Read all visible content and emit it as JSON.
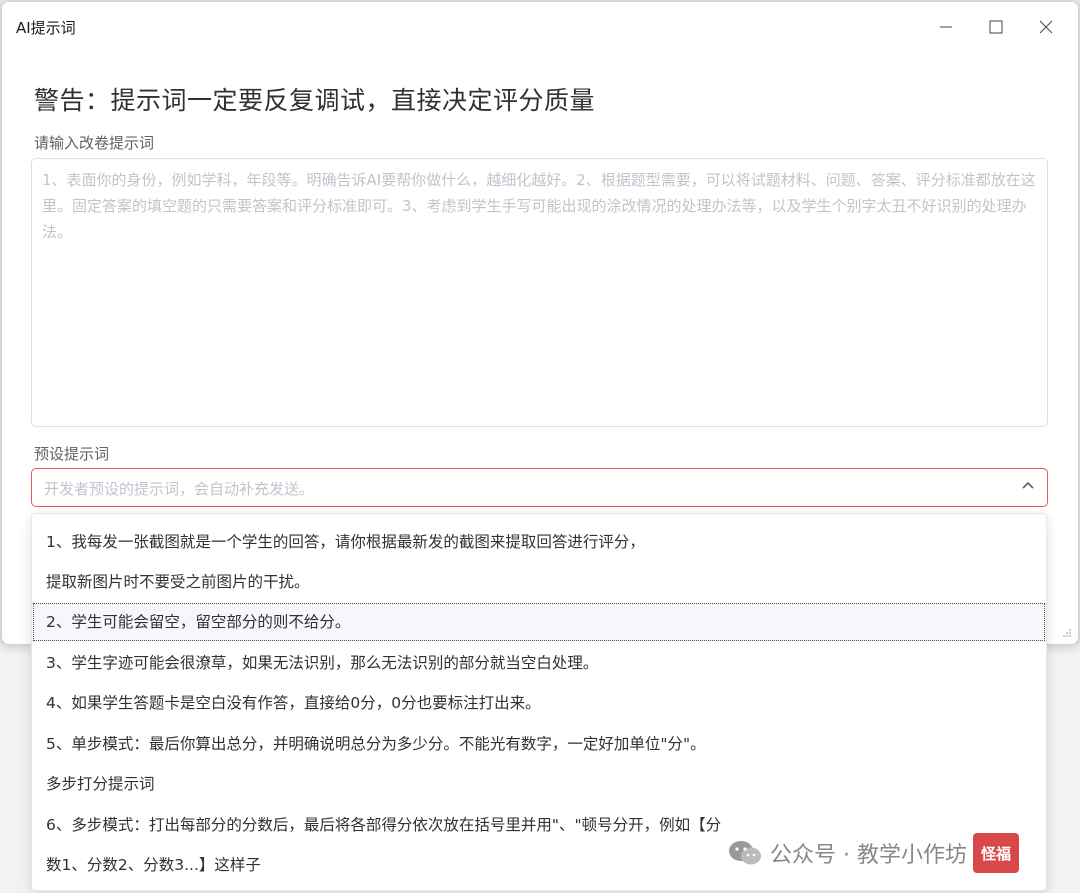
{
  "window": {
    "title": "AI提示词"
  },
  "main": {
    "warning": "警告：提示词一定要反复调试，直接决定评分质量",
    "prompt_label": "请输入改卷提示词",
    "prompt_placeholder": "1、表面你的身份，例如学科，年段等。明确告诉AI要帮你做什么，越细化越好。2、根据题型需要，可以将试题材料、问题、答案、评分标准都放在这里。固定答案的填空题的只需要答案和评分标准即可。3、考虑到学生手写可能出现的涂改情况的处理办法等，以及学生个别字太丑不好识别的处理办法。",
    "preset_label": "预设提示词",
    "preset_placeholder": "开发者预设的提示词，会自动补充发送。"
  },
  "dropdown": {
    "options": [
      "1、我每发一张截图就是一个学生的回答，请你根据最新发的截图来提取回答进行评分，",
      "提取新图片时不要受之前图片的干扰。",
      "2、学生可能会留空，留空部分的则不给分。",
      "3、学生字迹可能会很潦草，如果无法识别，那么无法识别的部分就当空白处理。",
      "4、如果学生答题卡是空白没有作答，直接给0分，0分也要标注打出来。",
      "5、单步模式：最后你算出总分，并明确说明总分为多少分。不能光有数字，一定好加单位\"分\"。",
      "多步打分提示词",
      "6、多步模式：打出每部分的分数后，最后将各部得分依次放在括号里并用\"、\"顿号分开，例如【分",
      "数1、分数2、分数3...】这样子"
    ],
    "focused_index": 2
  },
  "watermark": {
    "text": "公众号 · 教学小作坊",
    "stamp": "怪福"
  },
  "colors": {
    "error_border": "#e05a5a",
    "placeholder": "#c0c4cc"
  }
}
